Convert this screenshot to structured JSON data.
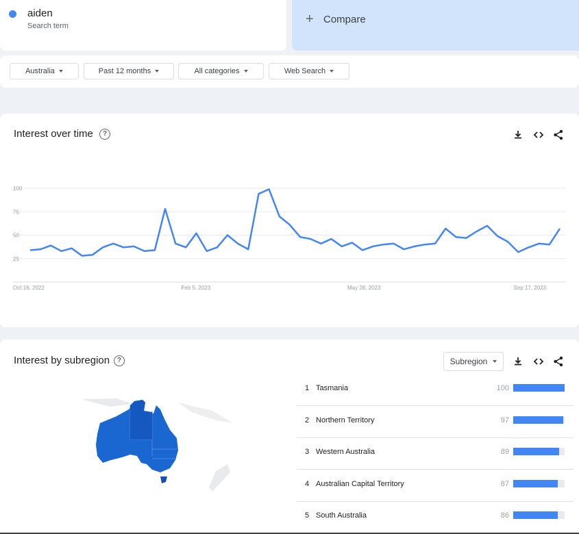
{
  "search_term": {
    "name": "aiden",
    "subtitle": "Search term"
  },
  "compare": {
    "label": "Compare"
  },
  "filters": [
    {
      "label": "Australia"
    },
    {
      "label": "Past 12 months"
    },
    {
      "label": "All categories"
    },
    {
      "label": "Web Search"
    }
  ],
  "interest_over_time": {
    "title": "Interest over time",
    "help_icon": "?",
    "tools": [
      "download-icon",
      "embed-icon",
      "share-icon"
    ]
  },
  "chart_data": {
    "type": "line",
    "ylim": [
      0,
      100
    ],
    "yticks": [
      "100",
      "75",
      "50",
      "25"
    ],
    "x_tick_labels": [
      "Oct 16, 2022",
      "Feb 5, 2023",
      "May 28, 2023",
      "Sep 17, 2023"
    ],
    "x_start": "Oct 16, 2022",
    "series": [
      {
        "color": "#4285f4",
        "values": [
          34,
          35,
          39,
          33,
          36,
          28,
          29,
          37,
          41,
          37,
          38,
          33,
          34,
          78,
          41,
          37,
          52,
          33,
          37,
          50,
          41,
          35,
          94,
          99,
          70,
          61,
          48,
          46,
          41,
          46,
          38,
          42,
          34,
          38,
          40,
          41,
          35,
          38,
          40,
          41,
          57,
          48,
          47,
          54,
          60,
          49,
          43,
          32,
          37,
          41,
          40,
          57
        ]
      }
    ]
  },
  "interest_by_subregion": {
    "title": "Interest by subregion",
    "help_icon": "?",
    "select_label": "Subregion",
    "rows": [
      {
        "rank": "1",
        "name": "Tasmania",
        "value": "100",
        "fill": 100
      },
      {
        "rank": "2",
        "name": "Northern Territory",
        "value": "97",
        "fill": 97
      },
      {
        "rank": "3",
        "name": "Western Australia",
        "value": "89",
        "fill": 89
      },
      {
        "rank": "4",
        "name": "Australian Capital Territory",
        "value": "87",
        "fill": 87
      },
      {
        "rank": "5",
        "name": "South Australia",
        "value": "86",
        "fill": 86
      }
    ]
  },
  "colors": {
    "accent": "#4285f4",
    "compare_bg": "#d2e3fc",
    "map_fill": "#1a67d2"
  }
}
